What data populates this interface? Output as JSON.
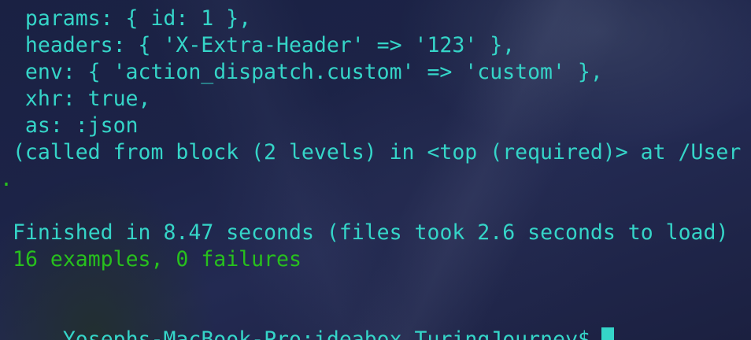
{
  "terminal": {
    "lines": [
      "  params: { id: 1 },",
      "  headers: { 'X-Extra-Header' => '123' },",
      "  env: { 'action_dispatch.custom' => 'custom' },",
      "  xhr: true,",
      "  as: :json",
      " (called from block (2 levels) in <top (required)> at /User",
      "."
    ],
    "finished_line": "Finished in 8.47 seconds (files took 2.6 seconds to load)",
    "summary_line": "16 examples, 0 failures",
    "prompt": "Yosephs-MacBook-Pro:ideabox TuringJourney$"
  },
  "colors": {
    "text": "#35d5c8",
    "success": "#27c01d",
    "cursor": "#35d5c8"
  }
}
